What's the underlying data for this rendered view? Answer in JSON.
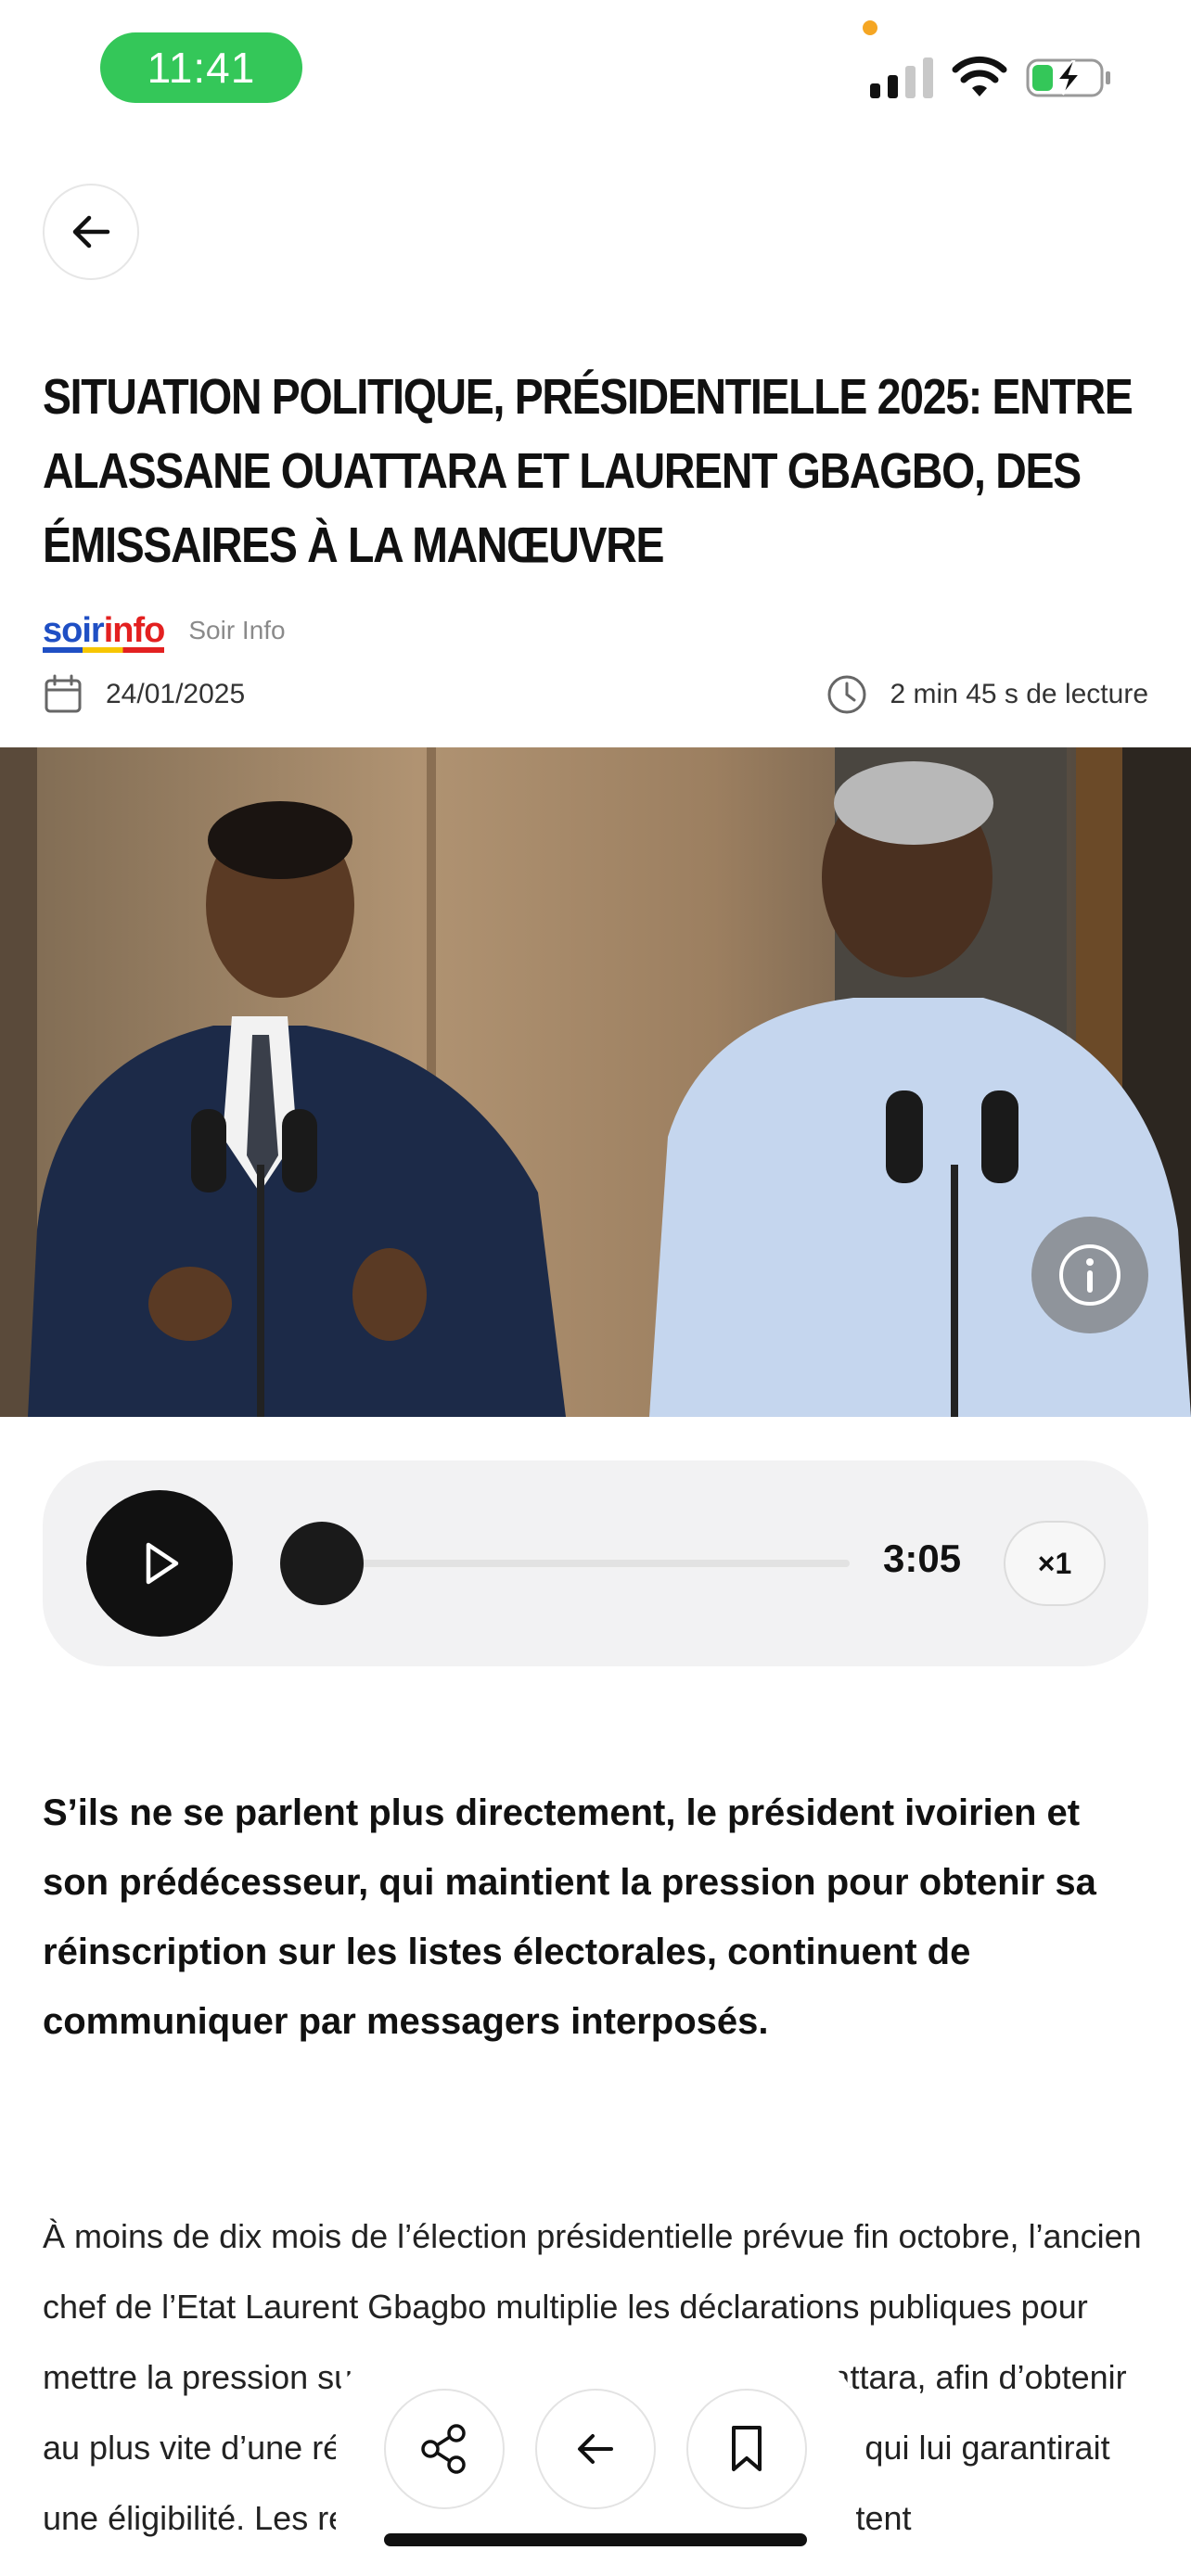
{
  "status_bar": {
    "time": "11:41",
    "icons": [
      "cellular-signal-icon",
      "wifi-icon",
      "battery-charging-icon"
    ]
  },
  "navigation": {
    "back_icon": "arrow-left-icon"
  },
  "article": {
    "title": "SITUATION POLITIQUE, PRÉSIDENTIELLE 2025: ENTRE ALASSANE OUATTARA ET LAURENT GBAGBO, DES ÉMISSAIRES À LA MANŒUVRE",
    "source": {
      "logo_part1": "soir",
      "logo_part2": "info",
      "name": "Soir Info"
    },
    "date": "24/01/2025",
    "reading_time": "2 min 45 s de lecture",
    "lead": "S’ils ne se parlent plus directement, le président ivoirien et son prédécesseur, qui maintient la pression pour obtenir sa réinscription sur les listes électorales, continuent de communiquer par messagers interposés.",
    "body": "À moins de dix mois de l’élection présidentielle prévue fin octobre, l’ancien chef de l’Etat Laurent Gbagbo multiplie les déclarations publiques pour mettre la pression sur l’actuel président, Alassane Ouattara, afin d’obtenir au plus vite d’une réinscription sur les listes électorales qui lui garantirait une éligibilité. Les relations entre les deux hommes restent"
  },
  "audio_player": {
    "duration": "3:05",
    "speed": "×1",
    "progress": 0
  },
  "toolbar": {
    "share_icon": "share-icon",
    "back_icon": "arrow-left-icon",
    "bookmark_icon": "bookmark-icon"
  },
  "colors": {
    "time_pill": "#34c759",
    "player_bg": "#f2f2f3",
    "play_button": "#111111",
    "logo_blue": "#1f4fc4",
    "logo_red": "#e32020"
  }
}
